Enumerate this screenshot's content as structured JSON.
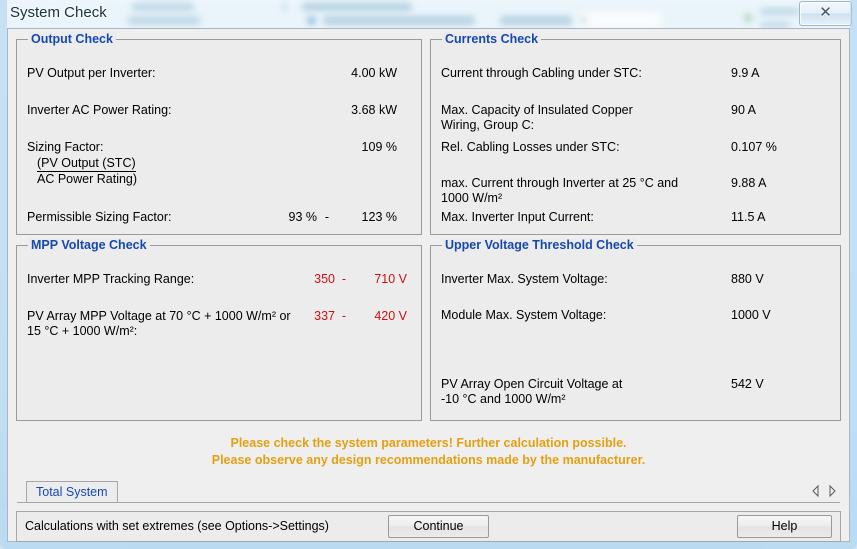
{
  "window": {
    "title": "System Check",
    "close_label": "✕"
  },
  "output_check": {
    "legend": "Output Check",
    "rows": [
      {
        "label": "PV Output per Inverter:",
        "value": "4.00 kW"
      },
      {
        "label": "Inverter AC Power Rating:",
        "value": "3.68 kW"
      },
      {
        "label": "Sizing Factor:",
        "value": "109 %"
      }
    ],
    "fraction": {
      "numerator": "(PV Output (STC)",
      "denominator": "AC Power Rating)"
    },
    "permissible": {
      "label": "Permissible Sizing Factor:",
      "min": "93 %",
      "dash": "-",
      "max": "123 %"
    }
  },
  "currents_check": {
    "legend": "Currents Check",
    "rows": [
      {
        "label": "Current through Cabling under STC:",
        "value": "9.9 A"
      },
      {
        "label": "Max. Capacity of Insulated Copper",
        "label2": "Wiring, Group C:",
        "value": "90 A"
      },
      {
        "label": "Rel. Cabling Losses under STC:",
        "value": "0.107 %"
      },
      {
        "label": "max. Current through Inverter at 25 °C and",
        "label2": "1000 W/m²",
        "value": "9.88 A"
      },
      {
        "label": "Max. Inverter Input Current:",
        "value": "11.5 A"
      }
    ]
  },
  "mpp_voltage_check": {
    "legend": "MPP Voltage Check",
    "rows": [
      {
        "label": "Inverter MPP Tracking Range:",
        "min": "350",
        "dash": "-",
        "max": "710 V"
      },
      {
        "label": "PV Array MPP Voltage at 70 °C + 1000 W/m² or",
        "label2": "15 °C + 1000 W/m²:",
        "min": "337",
        "dash": "-",
        "max": "420 V"
      }
    ]
  },
  "upper_voltage_threshold_check": {
    "legend": "Upper Voltage Threshold Check",
    "rows": [
      {
        "label": "Inverter Max. System Voltage:",
        "value": "880 V"
      },
      {
        "label": "Module Max. System Voltage:",
        "value": "1000 V"
      },
      {
        "label": "PV Array Open Circuit Voltage at",
        "label2": "-10 °C and 1000 W/m²",
        "value": "542 V"
      }
    ]
  },
  "warning": {
    "line1": "Please check the system parameters! Further calculation possible.",
    "line2": "Please observe any design recommendations made by the manufacturer.",
    "color": "#e3a012"
  },
  "tabs": {
    "items": [
      {
        "label": "Total System"
      }
    ]
  },
  "statusbar": {
    "text": "Calculations with set extremes (see Options->Settings)",
    "continue_label": "Continue",
    "help_label": "Help"
  },
  "colors": {
    "legend_blue": "#1649b0",
    "value_red": "#cc1111",
    "warning_orange": "#e3a012",
    "panel_bg": "#ececec"
  }
}
